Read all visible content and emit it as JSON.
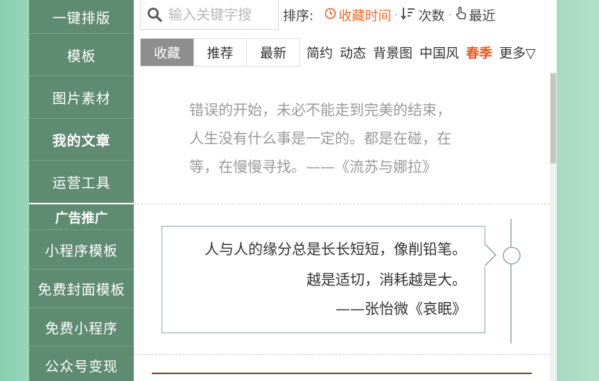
{
  "sidebar": {
    "items": [
      {
        "label": "一键排版"
      },
      {
        "label": "模板"
      },
      {
        "label": "图片素材"
      },
      {
        "label": "我的文章"
      },
      {
        "label": "运营工具"
      }
    ],
    "heading": "广告推广",
    "promo_items": [
      {
        "label": "小程序模板"
      },
      {
        "label": "免费封面模板"
      },
      {
        "label": "免费小程序"
      },
      {
        "label": "公众号变现"
      }
    ]
  },
  "search": {
    "placeholder": "输入关键字搜",
    "value": ""
  },
  "sort": {
    "label": "排序:",
    "options": [
      {
        "label": "收藏时间",
        "icon": "clock-icon",
        "active": true
      },
      {
        "label": "次数",
        "icon": "sort-desc-icon",
        "active": false
      },
      {
        "label": "最近",
        "icon": "hand-pointer-icon",
        "active": false
      }
    ],
    "separator": "·"
  },
  "tabs": [
    {
      "label": "收藏",
      "active": true
    },
    {
      "label": "推荐",
      "active": false
    },
    {
      "label": "最新",
      "active": false
    }
  ],
  "categories": [
    {
      "label": "简约"
    },
    {
      "label": "动态"
    },
    {
      "label": "背景图"
    },
    {
      "label": "中国风"
    },
    {
      "label": "春季",
      "highlight": true
    },
    {
      "label": "更多▽"
    }
  ],
  "cards": {
    "quote1": {
      "lines": [
        "错误的开始，未必不能走到完美的结束，",
        "人生没有什么事是一定的。都是在碰，在",
        "等，在慢慢寻找。——《流苏与娜拉》"
      ]
    },
    "quote2": {
      "lines": [
        "人与人的缘分总是长长短短，像削铅笔。",
        "越是适切，消耗越是大。",
        "——张怡微《哀眠》"
      ]
    }
  },
  "colors": {
    "sidebar_bg": "#5f8b73",
    "accent_orange": "#f06a2a",
    "active_tab_bg": "#8e8e8e",
    "box_border": "#8aa0b0"
  }
}
